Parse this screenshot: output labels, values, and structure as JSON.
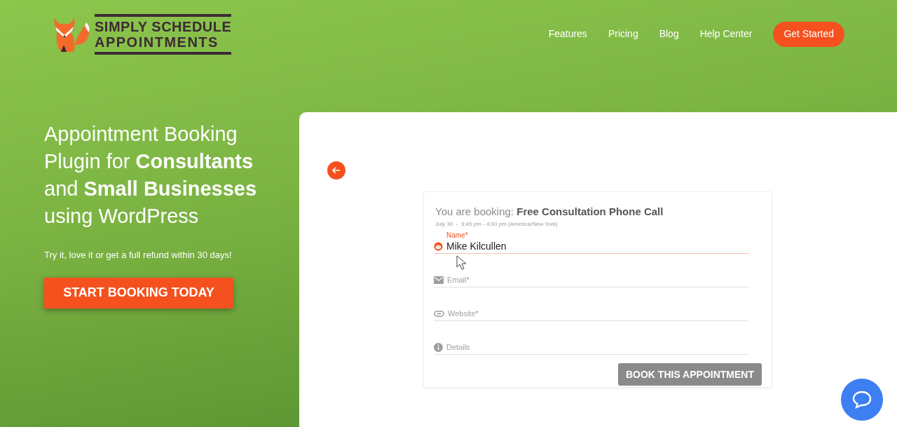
{
  "logo": {
    "line_1": "SIMPLY SCHEDULE",
    "line_2": "APPOINTMENTS"
  },
  "nav": {
    "links": [
      "Features",
      "Pricing",
      "Blog",
      "Help Center"
    ],
    "cta": "Get Started"
  },
  "hero": {
    "headline": "Appointment Booking Plugin for **Consultants** and **Small Businesses** using WordPress",
    "subtext": "Try it, love it or get a full refund within 30 days!",
    "button": "START BOOKING TODAY"
  },
  "booking": {
    "intro": "You are booking:",
    "title": "Free Consultation Phone Call",
    "when": "July 30  -  3:45 pm - 4:00 pm (America/New York)",
    "fields": [
      {
        "kind": "person",
        "label": "Name*",
        "value": "Mike Kilcullen",
        "focused": true
      },
      {
        "kind": "email",
        "label": "Email*",
        "focused": false
      },
      {
        "kind": "link",
        "label": "Website*",
        "focused": false
      },
      {
        "kind": "info",
        "label": "Details",
        "focused": false
      }
    ],
    "button": "BOOK THIS APPOINTMENT"
  }
}
